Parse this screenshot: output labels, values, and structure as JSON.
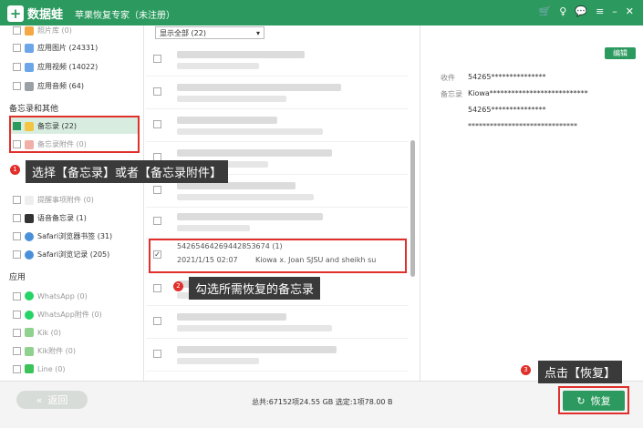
{
  "app": {
    "logo_text": "数据蛙",
    "title": "苹果恢复专家（未注册）",
    "controls": [
      "🛒",
      "♀",
      "💬",
      "≡",
      "–",
      "✕"
    ]
  },
  "sidebar": {
    "top_items": [
      {
        "label": "照片库 (0)",
        "dim": true
      },
      {
        "label": "应用图片 (24331)",
        "dim": false
      },
      {
        "label": "应用视频 (14022)",
        "dim": false
      },
      {
        "label": "应用音频 (64)",
        "dim": false
      }
    ],
    "section_memo": "备忘录和其他",
    "memo_items": [
      {
        "label": "备忘录 (22)",
        "dim": false,
        "checked": true
      },
      {
        "label": "备忘录附件 (0)",
        "dim": true,
        "checked": false
      },
      {
        "label": "提醒事项附件 (0)",
        "dim": true,
        "checked": false
      },
      {
        "label": "语音备忘录 (1)",
        "dim": false,
        "checked": false
      },
      {
        "label": "Safari浏览器书签 (31)",
        "dim": false,
        "checked": false
      },
      {
        "label": "Safari浏览记录 (205)",
        "dim": false,
        "checked": false
      }
    ],
    "section_app": "应用",
    "app_items": [
      {
        "label": "WhatsApp (0)",
        "dim": true
      },
      {
        "label": "WhatsApp附件 (0)",
        "dim": true
      },
      {
        "label": "Kik (0)",
        "dim": true
      },
      {
        "label": "Kik附件 (0)",
        "dim": true
      },
      {
        "label": "Line (0)",
        "dim": true
      }
    ]
  },
  "list": {
    "filter_value": "显示全部 (22)",
    "selected_title": "54265464269442853674 (1)",
    "selected_date": "2021/1/15 02:07",
    "selected_preview": "Kiowa x. Joan SJSU and sheikh su"
  },
  "detail": {
    "edit_label": "编辑",
    "from_label": "收件",
    "from_value": "54265***************",
    "note_label": "备忘录",
    "note_value": "Kiowa***************************",
    "line3": "54265***************",
    "line4": "******************************"
  },
  "bottom": {
    "back_label": "返回",
    "stats": "总共:67152项24.55 GB 选定:1项78.00 B",
    "recover_label": "恢复"
  },
  "annotations": {
    "step1_num": "1",
    "step1": "选择【备忘录】或者【备忘录附件】",
    "step2_num": "2",
    "step2": "勾选所需恢复的备忘录",
    "step3_num": "3",
    "step3": "点击【恢复】"
  },
  "colors": {
    "brand": "#2c9a5f",
    "highlight": "#e0302b"
  }
}
